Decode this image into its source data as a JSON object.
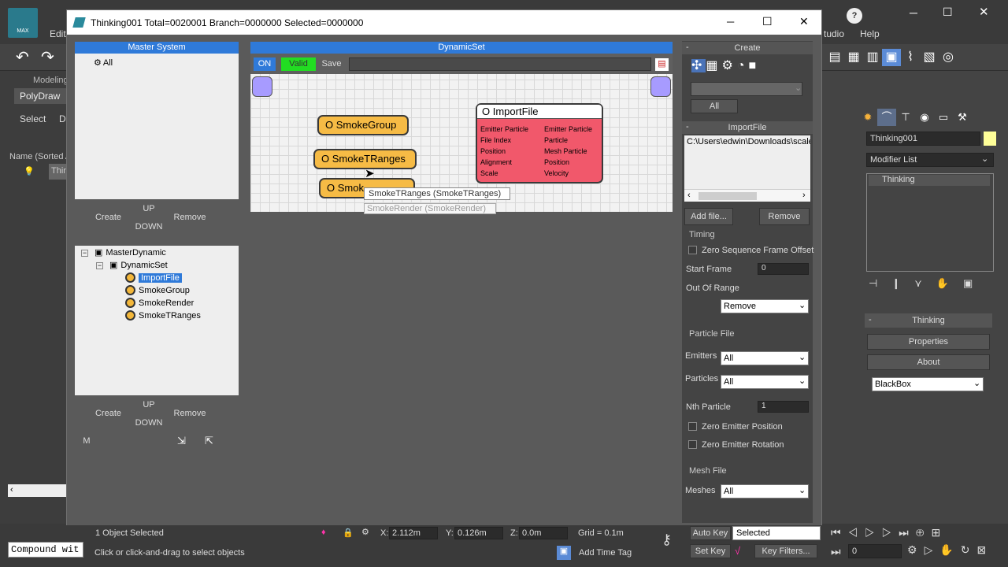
{
  "background_app": {
    "logo_text": "MAX",
    "menu": [
      "Edit",
      "tudio",
      "Help"
    ],
    "modeling_tab": "Modeling",
    "polydraw_tab": "PolyDraw",
    "select_label": "Select",
    "d_label": "D",
    "name_sorted": "Name (Sorted A",
    "scene_item": "Thin",
    "compound_field": "Compound wit"
  },
  "right_panel": {
    "object_name": "Thinking001",
    "modifier_list": "Modifier List",
    "stack_item": "Thinking",
    "rollout_title": "Thinking",
    "properties_btn": "Properties",
    "about_btn": "About",
    "blackbox_value": "BlackBox"
  },
  "window": {
    "title": "Thinking001  Total=0020001  Branch=0000000  Selected=0000000",
    "min": "─",
    "max": "☐",
    "close": "✕"
  },
  "master_system": {
    "header": "Master System",
    "items": [
      "All"
    ],
    "create": "Create",
    "up": "UP",
    "down": "DOWN",
    "remove": "Remove"
  },
  "tree": {
    "root": "MasterDynamic",
    "child": "DynamicSet",
    "leaves": [
      "ImportFile",
      "SmokeGroup",
      "SmokeRender",
      "SmokeTRanges"
    ],
    "selected_leaf": "ImportFile",
    "create": "Create",
    "up": "UP",
    "down": "DOWN",
    "remove": "Remove",
    "m_button": "M"
  },
  "dynamic_set": {
    "header": "DynamicSet",
    "on_btn": "ON",
    "valid_btn": "Valid",
    "save_btn": "Save",
    "nodes": {
      "smoke_group": "O SmokeGroup",
      "smoke_tranges": "O SmokeTRanges",
      "smoke_render": "O Smok",
      "import_file": "O ImportFile"
    },
    "import_left": [
      "Emitter Particle",
      "File Index",
      "Position",
      "Alignment",
      "Scale"
    ],
    "import_right": [
      "Emitter Particle",
      "Particle",
      "Mesh Particle",
      "Position",
      "Velocity"
    ],
    "tooltip1": "SmokeTRanges (SmokeTRanges)",
    "tooltip2": "SmokeRender (SmokeRender)"
  },
  "create_panel": {
    "header": "Create",
    "all_btn": "All"
  },
  "import_panel": {
    "header": "ImportFile",
    "path": "C:\\Users\\edwin\\Downloads\\scale",
    "add_file": "Add file...",
    "remove": "Remove",
    "timing": "Timing",
    "zero_seq": "Zero Sequence Frame Offset",
    "start_frame_label": "Start Frame",
    "start_frame_value": "0",
    "out_of_range_label": "Out Of Range",
    "out_of_range_value": "Remove",
    "particle_file": "Particle File",
    "emitters_label": "Emitters",
    "emitters_value": "All",
    "particles_label": "Particles",
    "particles_value": "All",
    "nth_label": "Nth Particle",
    "nth_value": "1",
    "zero_emitter_pos": "Zero Emitter Position",
    "zero_emitter_rot": "Zero Emitter Rotation",
    "mesh_file": "Mesh File",
    "meshes_label": "Meshes",
    "meshes_value": "All"
  },
  "status": {
    "objects_selected": "1 Object Selected",
    "hint": "Click or click-and-drag to select objects",
    "x_label": "X:",
    "x_value": "2.112m",
    "y_label": "Y:",
    "y_value": "0.126m",
    "z_label": "Z:",
    "z_value": "0.0m",
    "grid": "Grid = 0.1m",
    "add_time_tag": "Add Time Tag",
    "auto_key": "Auto Key",
    "selected": "Selected",
    "set_key": "Set Key",
    "key_filters": "Key Filters...",
    "frame": "0"
  }
}
